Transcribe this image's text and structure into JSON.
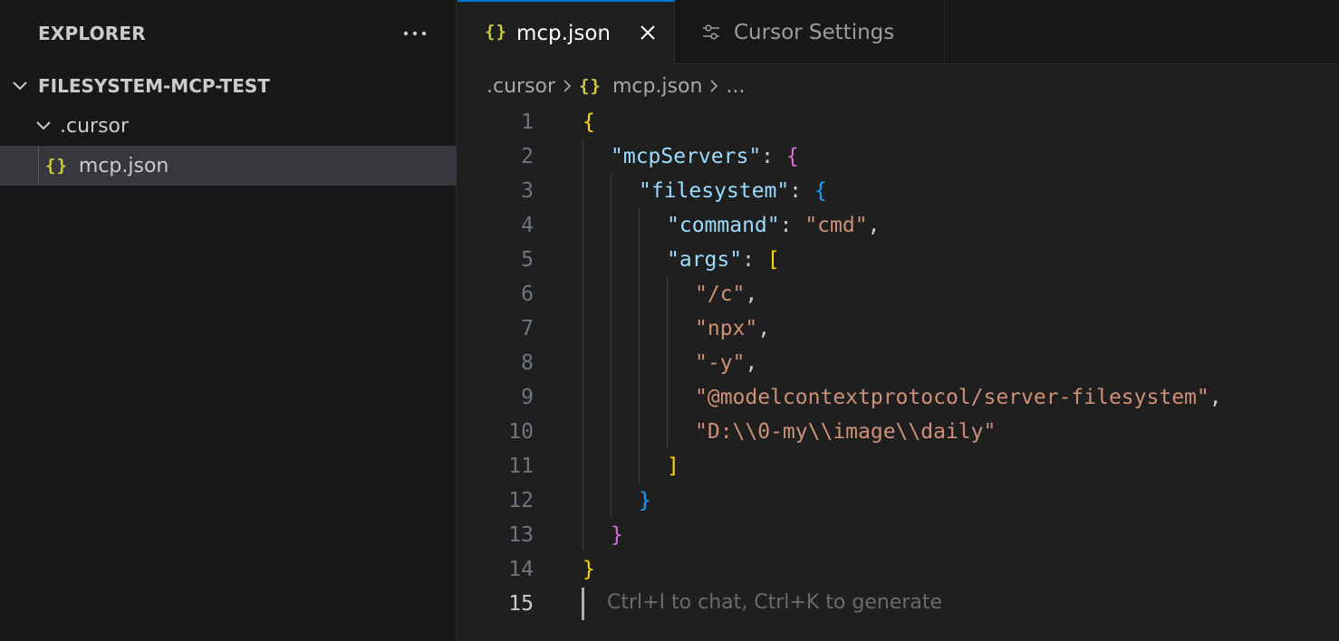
{
  "sidebar": {
    "title": "EXPLORER",
    "more_icon": "ellipsis-icon",
    "root": "FILESYSTEM-MCP-TEST",
    "folder": ".cursor",
    "file": "mcp.json",
    "file_icon_text": "{}"
  },
  "tabs": {
    "active": {
      "label": "mcp.json",
      "icon_text": "{}"
    },
    "inactive": {
      "label": "Cursor Settings",
      "icon": "settings-sliders-icon"
    }
  },
  "breadcrumb": {
    "folder": ".cursor",
    "file_icon_text": "{}",
    "file": "mcp.json",
    "more": "..."
  },
  "editor": {
    "current_line": 15,
    "line_numbers": [
      "1",
      "2",
      "3",
      "4",
      "5",
      "6",
      "7",
      "8",
      "9",
      "10",
      "11",
      "12",
      "13",
      "14",
      "15"
    ],
    "tokens": {
      "l1_brace": "{",
      "l2_key": "\"mcpServers\"",
      "l2_colon": ": ",
      "l2_brace": "{",
      "l3_key": "\"filesystem\"",
      "l3_colon": ": ",
      "l3_brace": "{",
      "l4_key": "\"command\"",
      "l4_colon": ": ",
      "l4_val": "\"cmd\"",
      "l4_comma": ",",
      "l5_key": "\"args\"",
      "l5_colon": ": ",
      "l5_bracket": "[",
      "l6_val": "\"/c\"",
      "l6_comma": ",",
      "l7_val": "\"npx\"",
      "l7_comma": ",",
      "l8_val": "\"-y\"",
      "l8_comma": ",",
      "l9_val": "\"@modelcontextprotocol/server-filesystem\"",
      "l9_comma": ",",
      "l10_val": "\"D:\\\\0-my\\\\image\\\\daily\"",
      "l11_bracket": "]",
      "l12_brace": "}",
      "l13_brace": "}",
      "l14_brace": "}"
    },
    "hint": "Ctrl+I to chat, Ctrl+K to generate"
  },
  "colors": {
    "accent": "#0078d4",
    "json_icon": "#cbcb41",
    "key": "#9cdcfe",
    "string": "#ce9178",
    "bracket_level1": "#ffd700",
    "bracket_level2": "#da70d6",
    "bracket_level3": "#179fff"
  }
}
